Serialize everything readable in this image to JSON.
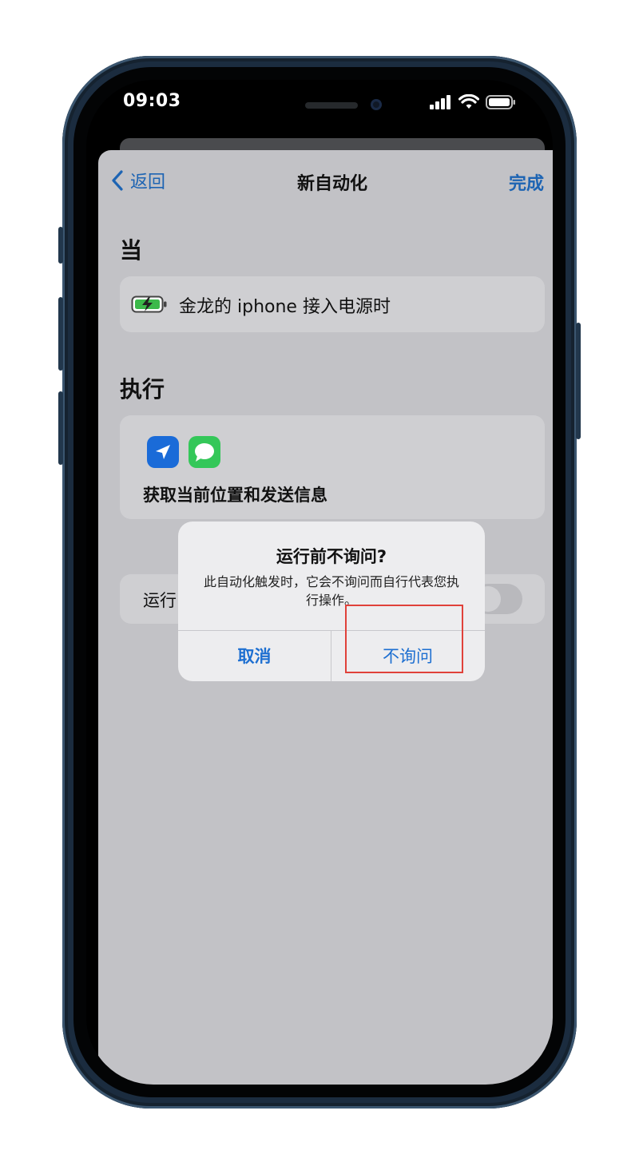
{
  "status_bar": {
    "time": "09:03"
  },
  "nav": {
    "back_label": "返回",
    "title": "新自动化",
    "done_label": "完成"
  },
  "when": {
    "heading": "当",
    "trigger_icon": "battery-charging-icon",
    "trigger_label": "金龙的 iphone 接入电源时"
  },
  "do": {
    "heading": "执行",
    "action_icons": [
      "location-arrow-icon",
      "messages-icon"
    ],
    "action_title": "获取当前位置和发送信息"
  },
  "ask_before": {
    "label_visible": "运行"
  },
  "dialog": {
    "title": "运行前不询问?",
    "message": "此自动化触发时，它会不询问而自行代表您执行操作。",
    "cancel_label": "取消",
    "confirm_label": "不询问"
  },
  "colors": {
    "accent": "#1d6fd1",
    "highlight": "#e0413a",
    "sheet": "#c2c2c6",
    "phone": "#1b2c3f"
  }
}
